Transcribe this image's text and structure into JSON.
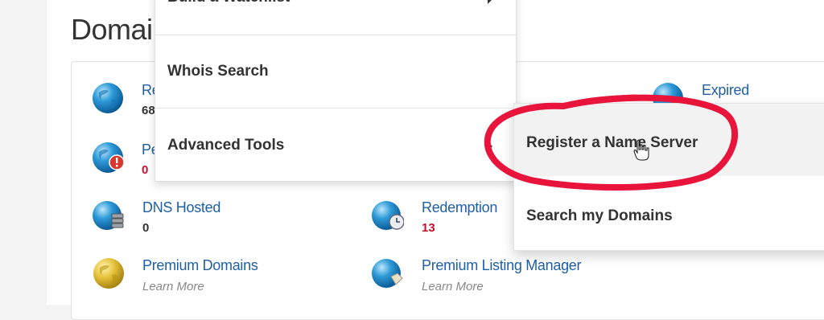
{
  "page": {
    "title": "Domain"
  },
  "tiles": [
    {
      "label": "Re",
      "count": "68",
      "count_color": "dark"
    },
    {
      "label": "Pe",
      "count": "0",
      "count_color": "red"
    },
    {
      "label": "DNS Hosted",
      "count": "0",
      "count_color": "dark"
    },
    {
      "label": "Premium Domains",
      "sub": "Learn More"
    },
    {
      "label": "Redemption",
      "count": "13",
      "count_color": "red"
    },
    {
      "label": "Premium Listing Manager",
      "sub": "Learn More"
    },
    {
      "label": "Expired"
    }
  ],
  "menu": {
    "items": [
      {
        "label": "Build a Watchlist"
      },
      {
        "label": "Whois Search"
      },
      {
        "label": "Advanced Tools"
      }
    ]
  },
  "submenu": {
    "items": [
      {
        "label": "Register a Name Server"
      },
      {
        "label": "Search my Domains"
      }
    ]
  },
  "annotation": {
    "color": "#e8143c",
    "shape": "hand-drawn-ellipse"
  },
  "colors": {
    "link": "#1f5fa6",
    "count_red": "#c8102e",
    "text": "#333333"
  }
}
